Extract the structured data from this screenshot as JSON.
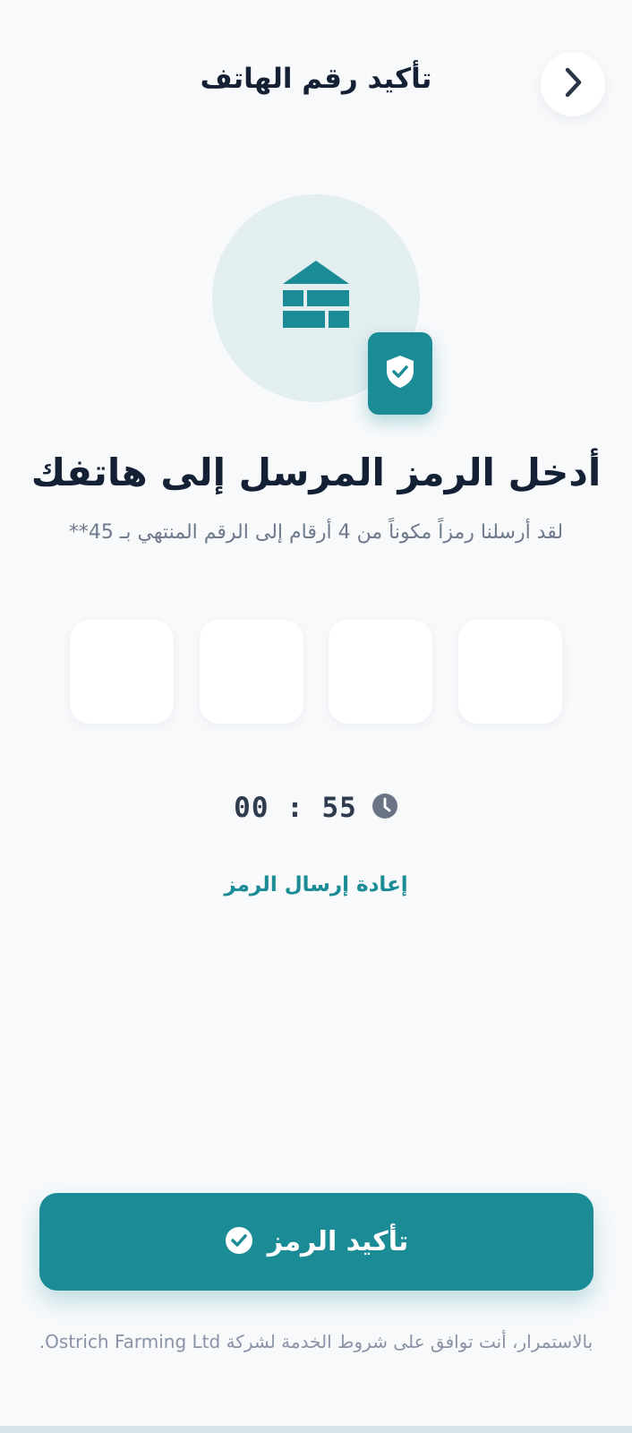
{
  "header": {
    "title": "تأكيد رقم الهاتف",
    "back_icon": "chevron-right-icon"
  },
  "illustration": {
    "main_icon": "brick-wall-icon",
    "badge_icon": "shield-check-icon"
  },
  "headline": "أدخل الرمز المرسل إلى هاتفك",
  "subtext": "لقد أرسلنا رمزاً مكوناً من 4 أرقام إلى الرقم المنتهي بـ 45**",
  "otp": {
    "digits": [
      "",
      "",
      "",
      ""
    ]
  },
  "timer": {
    "icon": "clock-icon",
    "text": "00 : 55"
  },
  "resend_label": "إعادة إرسال الرمز",
  "confirm_button": {
    "label": "تأكيد الرمز",
    "icon": "check-circle-icon"
  },
  "terms": "بالاستمرار، أنت توافق على شروط الخدمة لشركة Ostrich Farming Ltd.",
  "colors": {
    "accent": "#1b8c96",
    "background": "#f7f9fb",
    "text": "#142033",
    "muted": "#6e7a8c"
  }
}
